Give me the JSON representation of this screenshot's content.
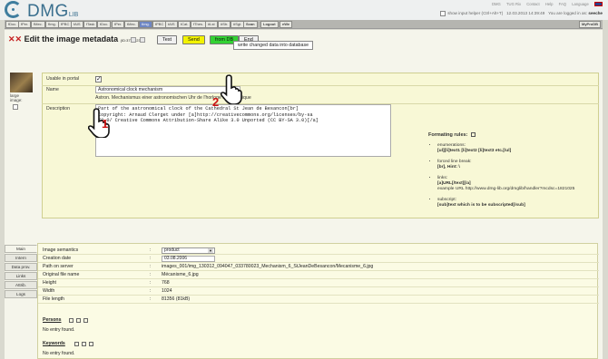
{
  "header": {
    "logo_main": "DMG",
    "logo_sub": "LIB",
    "links": [
      "DMG",
      "TUG Rix",
      "Contact",
      "Help",
      "FAQ",
      "Language"
    ],
    "input_helper_label": "show input helper (Ctrl+Alt+T)",
    "datetime": "12.03.2013 14:39:49",
    "logged_in_label": "You are logged in as:",
    "user": "seeche"
  },
  "nav": {
    "items": [
      "fDoc.",
      "fPer.",
      "fMec.",
      "fImg.",
      "fPBC",
      "fAIS",
      "fTask",
      "tDoc.",
      "tPer.",
      "tMec.",
      "tImg.",
      "tPBC",
      "tAIS",
      "tCat.",
      "fThes.",
      "#Lst",
      "#Str.",
      "#Sgt.",
      "Scan",
      "Logout",
      "eWe"
    ],
    "active_index": 10,
    "right": "MyProDB"
  },
  "title": {
    "text": "Edit the image metadata",
    "id": "(ID:3778623)",
    "buttons": {
      "test": "Test",
      "send": "Send",
      "from_db": "from DB",
      "end": "End"
    },
    "tooltip": "write changed data into database"
  },
  "thumb": {
    "label_1": "large",
    "label_2": "image:"
  },
  "form": {
    "usable_label": "Usable in portal",
    "name_label": "Name",
    "name_value": "Astronomical clock mechanism",
    "name_value2": "Astron. Mechanismus einer astronomischen Uhr",
    "name_value3": "de l'horloge astronomique",
    "description_label": "Description",
    "description_lines": [
      "Part of the astronomical clock of the Cathedral St Jean de Besancon[br]",
      "Copyright: Arnaud Clerget under [a]http://creativecommons.org/licenses/by-sa",
      "/3.0/ Creative Commons Attribution-Share Alike 3.0 Unported (CC BY-SA 3.0)[/a]"
    ]
  },
  "rules": {
    "title": "Formating rules:",
    "items": [
      {
        "label": "enumerations:",
        "example": "[ul][li]text1 [li]text2 [li]text3 etc.[/ul]"
      },
      {
        "label": "forced line break:",
        "example": "[br], Hint: \\"
      },
      {
        "label": "links:",
        "example": "[a]URL[/text][/a]",
        "example2": "example URL http://www.dmg-lib.org/dmglib/handler?mcdsc=1821025"
      },
      {
        "label": "subscript:",
        "example": "[sub]text which is to be subscripted[/sub]"
      }
    ]
  },
  "annotations": {
    "num1": "1",
    "num2": "2"
  },
  "tabs": [
    "Main",
    "Intern",
    "Data prov.",
    "Links",
    "Attrib.",
    "Logs"
  ],
  "semantics": {
    "rows": [
      {
        "key": "Image semantics",
        "value": "product"
      },
      {
        "key": "Creation date",
        "value": "03.08.2006"
      },
      {
        "key": "Path on server",
        "value": "images_001/img_130312_094047_033780023_Mechanism_6_StJeanDeBesancon/Mecanisme_6.jpg"
      },
      {
        "key": "Original file name",
        "value": "Mécanisme_6.jpg"
      },
      {
        "key": "Height",
        "value": "768"
      },
      {
        "key": "Width",
        "value": "1024"
      },
      {
        "key": "File length",
        "value": "81356 (81kB)"
      }
    ],
    "persons_title": "Persons",
    "persons_empty": "No entry found.",
    "keywords_title": "Keywords",
    "keywords_empty": "No entry found."
  }
}
